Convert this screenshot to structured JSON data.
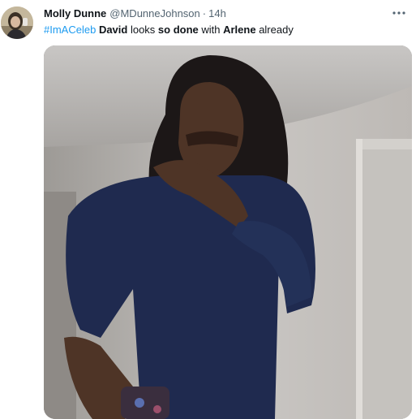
{
  "tweet": {
    "author_name": "Molly Dunne",
    "author_handle": "@MDunneJohnson",
    "separator": "·",
    "timestamp": "14h",
    "text": {
      "hashtag": "#ImACeleb",
      "name1": "David",
      "part1": " looks ",
      "emphasis": "so done",
      "part2": " with ",
      "name2": "Arlene",
      "part3": " already"
    },
    "more_icon": "more-horizontal-icon",
    "media_description_icon": "photo"
  },
  "colors": {
    "link": "#1d9bf0",
    "secondary_text": "#536471",
    "primary_text": "#0f1419"
  }
}
